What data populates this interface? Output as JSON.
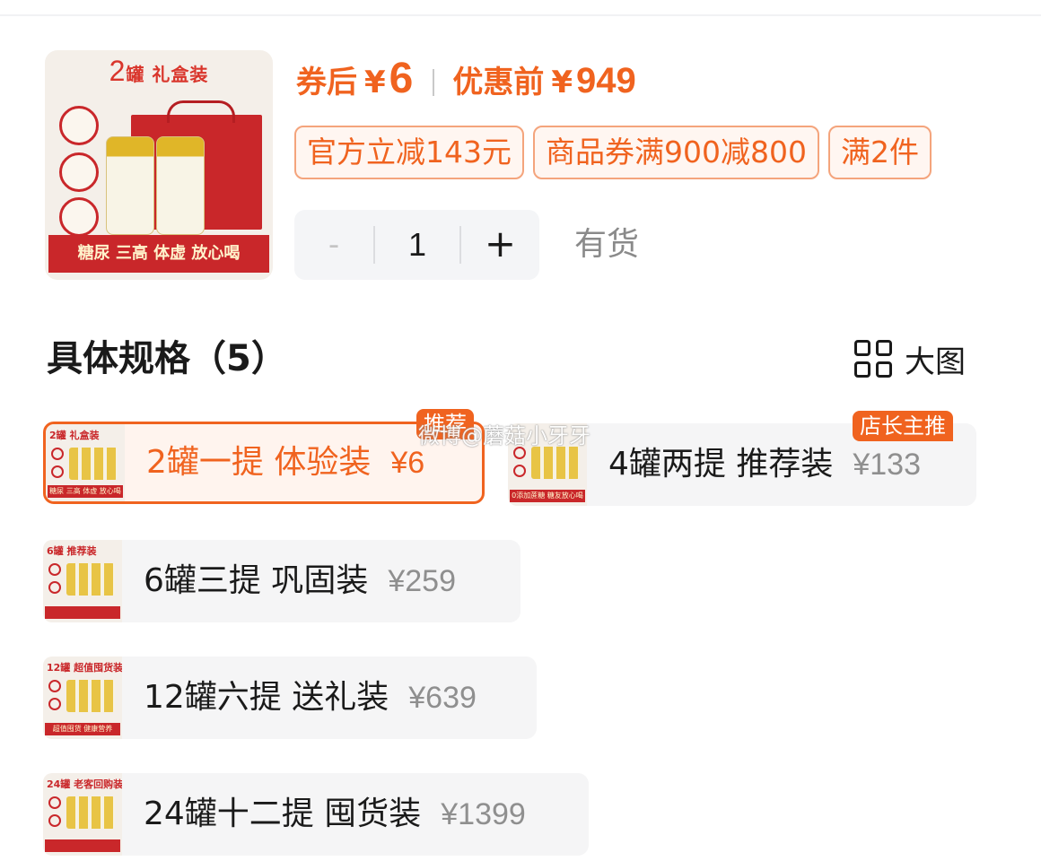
{
  "product": {
    "image": {
      "title_count": "2",
      "title_text": "罐 礼盒装",
      "banner": "糖尿 三高 体虚 放心喝"
    },
    "price_after_coupon_label": "券后",
    "price_after_coupon_currency": "¥",
    "price_after_coupon": "6",
    "price_before_label": "优惠前",
    "price_before_currency": "¥",
    "price_before": "949",
    "accent_color": "#f0631f"
  },
  "coupons": [
    "官方立减143元",
    "商品券满900减800",
    "满2件"
  ],
  "quantity": {
    "minus_label": "-",
    "value": "1",
    "plus_label": "+"
  },
  "stock_status": "有货",
  "specs_section": {
    "title": "具体规格（5）",
    "big_view_label": "大图"
  },
  "specs": [
    {
      "name": "2罐一提 体验装",
      "price": "¥6",
      "tag": "推荐",
      "selected": true,
      "thumb_title": "2罐 礼盒装",
      "thumb_banner": "糖尿 三高 体虚 放心喝"
    },
    {
      "name": "4罐两提 推荐装",
      "price": "¥133",
      "tag": "店长主推",
      "selected": false,
      "thumb_title": "",
      "thumb_banner": "0添加蔗糖 糖友放心喝"
    },
    {
      "name": "6罐三提 巩固装",
      "price": "¥259",
      "tag": "",
      "selected": false,
      "thumb_title": "6罐 推荐装",
      "thumb_banner": ""
    },
    {
      "name": "12罐六提 送礼装",
      "price": "¥639",
      "tag": "",
      "selected": false,
      "thumb_title": "12罐 超值囤货装",
      "thumb_banner": "超值囤货 健康营养"
    },
    {
      "name": "24罐十二提 囤货装",
      "price": "¥1399",
      "tag": "",
      "selected": false,
      "thumb_title": "24罐 老客回购装",
      "thumb_banner": ""
    }
  ],
  "watermark": "微博@蘑菇小牙牙"
}
